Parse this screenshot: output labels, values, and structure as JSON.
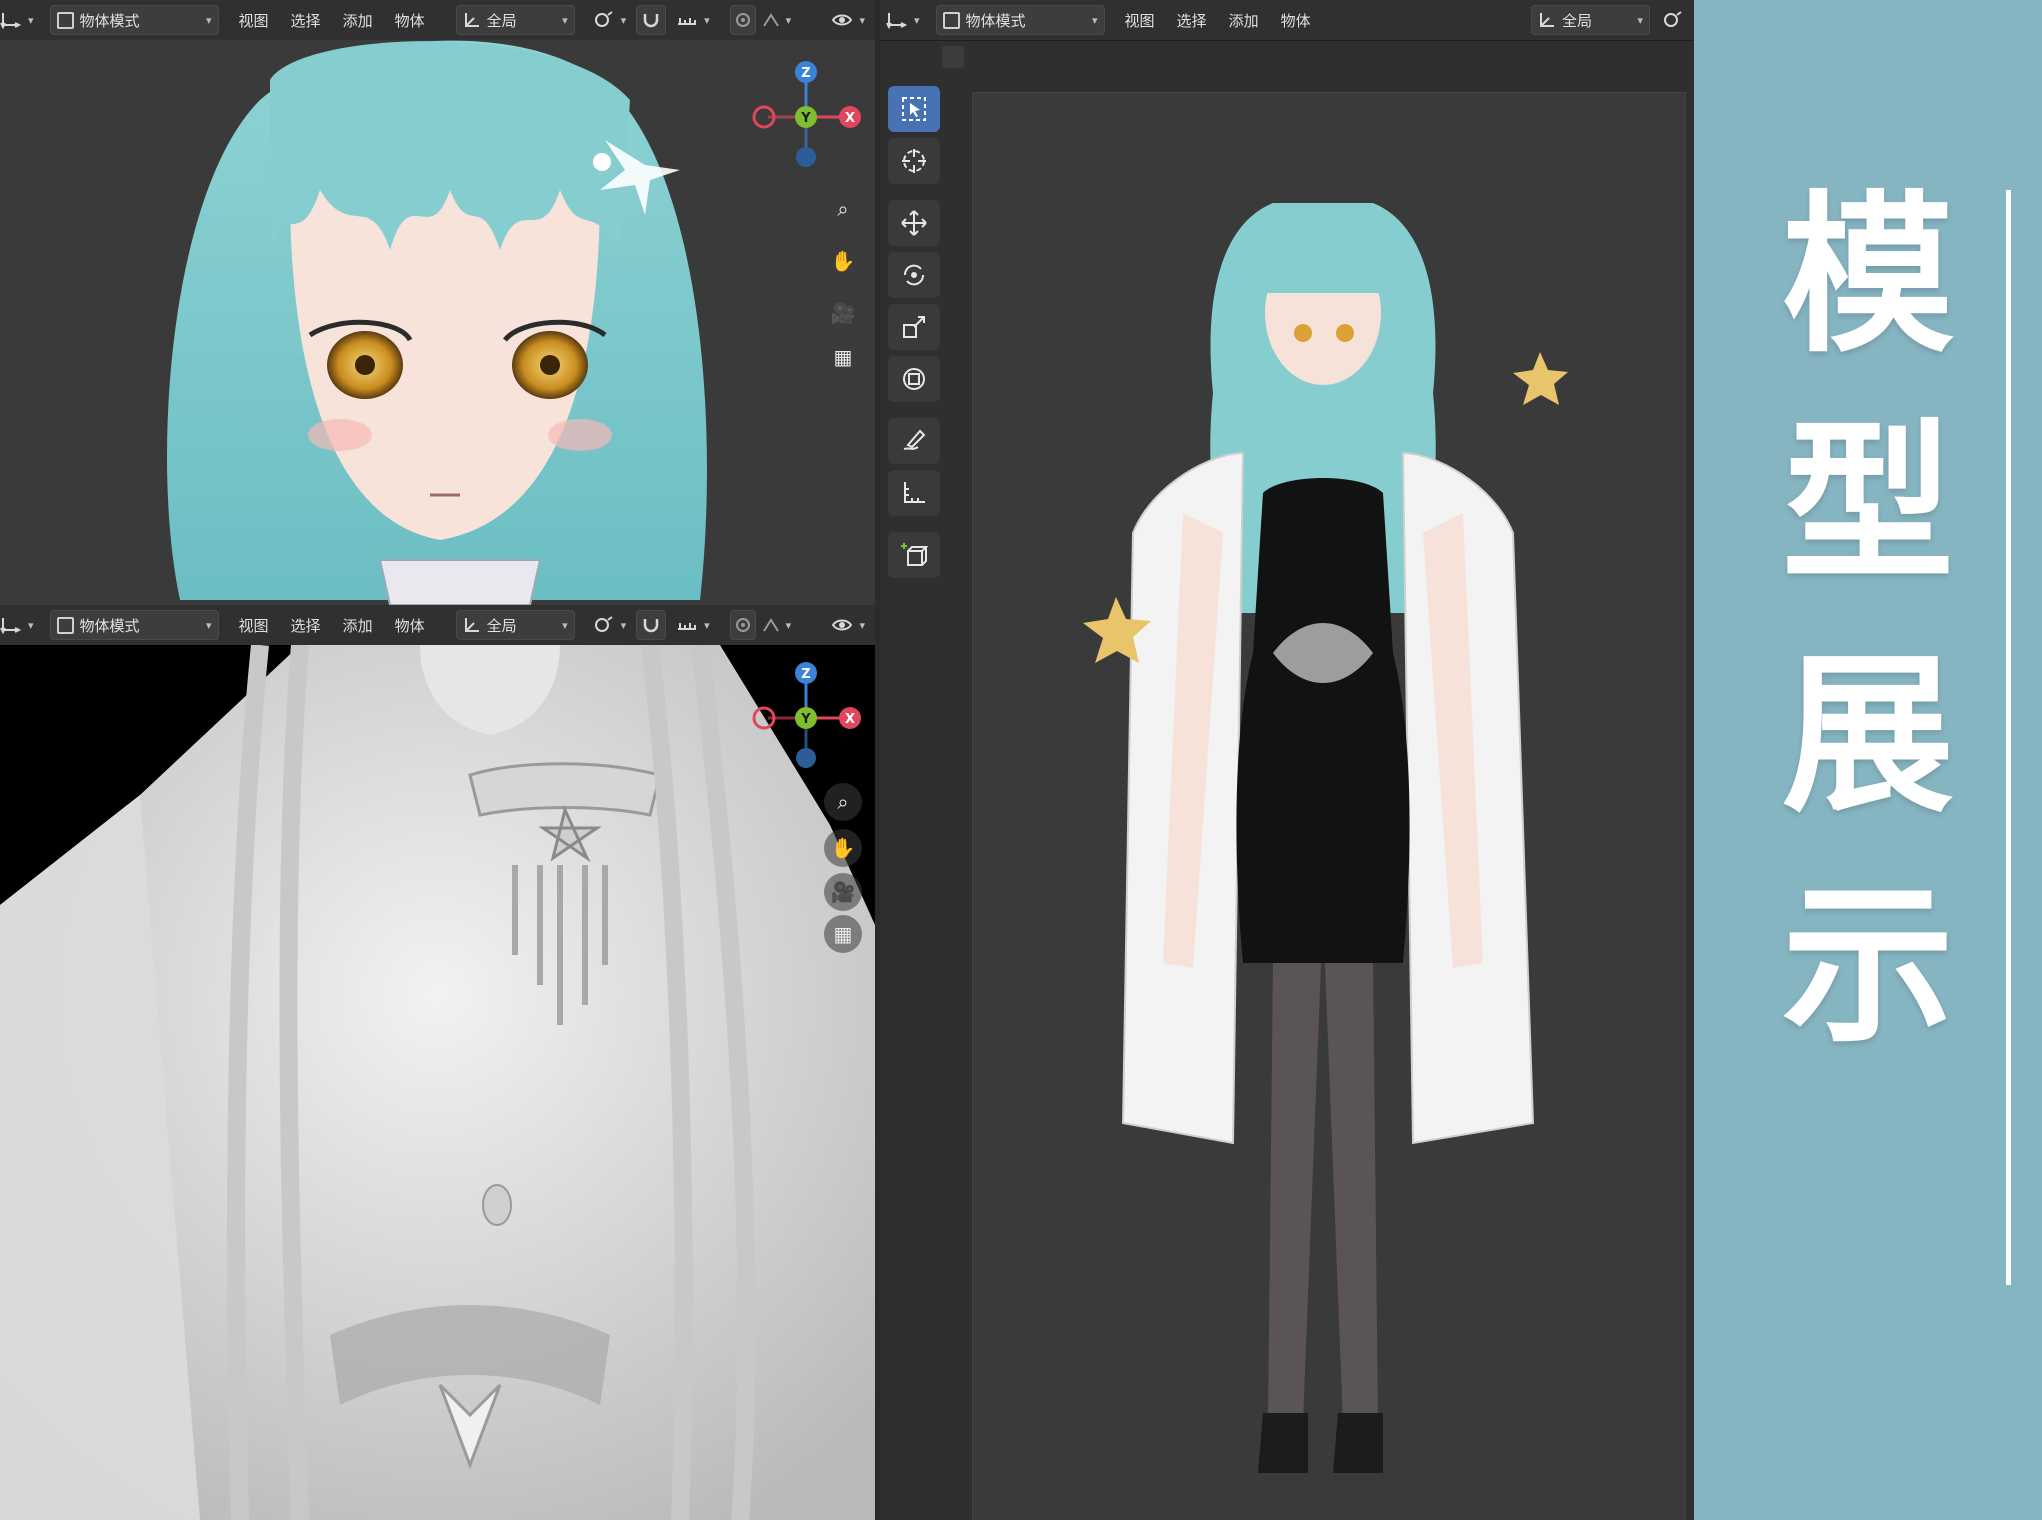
{
  "menus": {
    "view": "视图",
    "select": "选择",
    "add": "添加",
    "object": "物体"
  },
  "mode": "物体模式",
  "orientation": "全局",
  "sidebar_title": [
    "模",
    "型",
    "展",
    "示"
  ],
  "axis": {
    "x": "X",
    "y": "Y",
    "z": "Z"
  },
  "colors": {
    "sidebar": "#86b5c2",
    "accent": "#4772b3",
    "axis_x": "#e0475c",
    "axis_y": "#7fbf2f",
    "axis_z": "#3b83d6"
  },
  "icons": {
    "nav": [
      "zoom-icon",
      "hand-icon",
      "camera-icon",
      "grid-icon"
    ],
    "tools": [
      "select-box-icon",
      "cursor-icon",
      "move-icon",
      "rotate-icon",
      "scale-icon",
      "transform-icon",
      "annotate-icon",
      "measure-icon",
      "add-cube-icon"
    ]
  }
}
